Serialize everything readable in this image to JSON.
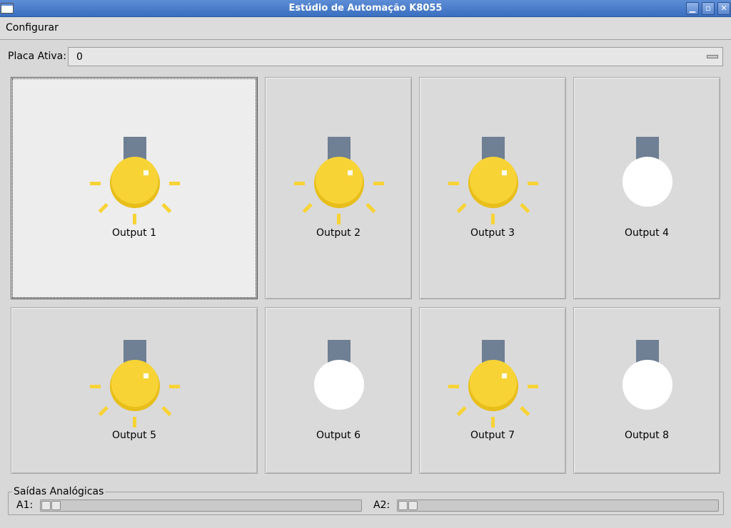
{
  "window": {
    "title": "Estúdio de Automação K8055",
    "buttons": {
      "minimize": "▁",
      "maximize": "▫",
      "close": "✕"
    }
  },
  "menu": {
    "items": [
      {
        "label": "Configurar"
      }
    ]
  },
  "placa": {
    "label": "Placa Ativa:",
    "value": "0"
  },
  "outputs": [
    {
      "label": "Output 1",
      "state": "on"
    },
    {
      "label": "Output 2",
      "state": "on"
    },
    {
      "label": "Output 3",
      "state": "on"
    },
    {
      "label": "Output 4",
      "state": "off"
    },
    {
      "label": "Output 5",
      "state": "on"
    },
    {
      "label": "Output 6",
      "state": "off"
    },
    {
      "label": "Output 7",
      "state": "on"
    },
    {
      "label": "Output 8",
      "state": "off"
    }
  ],
  "analog": {
    "legend": "Saídas Analógicas",
    "channels": [
      {
        "label": "A1:",
        "value": 0
      },
      {
        "label": "A2:",
        "value": 0
      }
    ]
  },
  "colors": {
    "bulb_on": "#f7d335",
    "bulb_on_shade": "#e8be1a",
    "bulb_off": "#ffffff",
    "bulb_cap": "#6f7f94",
    "titlebar": "#4a7ccb"
  }
}
